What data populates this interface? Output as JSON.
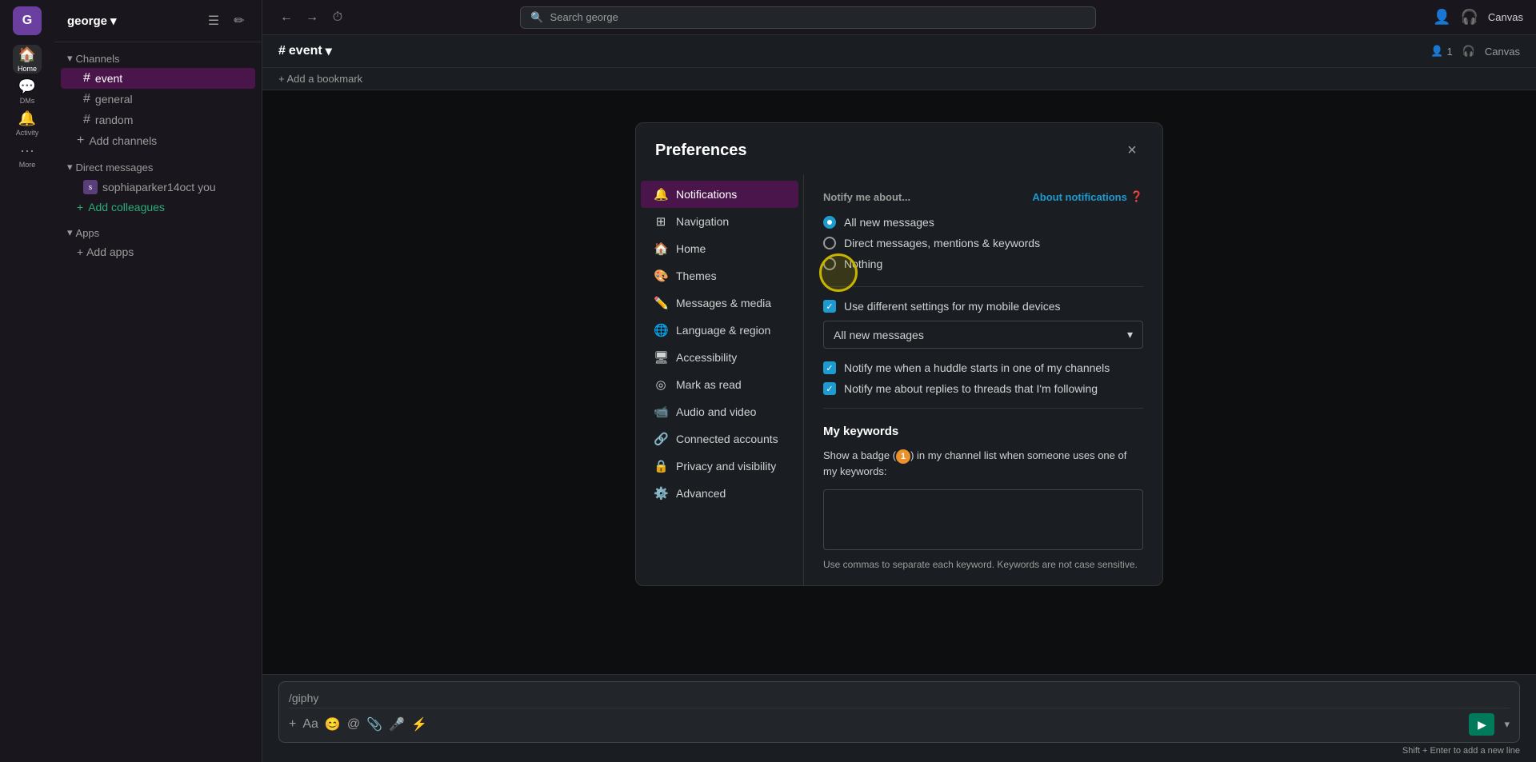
{
  "app": {
    "workspace_initial": "G",
    "workspace_name": "george",
    "workspace_arrow": "▾"
  },
  "app_sidebar": {
    "items": [
      {
        "id": "home",
        "icon": "🏠",
        "label": "Home",
        "active": true
      },
      {
        "id": "dms",
        "icon": "💬",
        "label": "DMs",
        "active": false
      },
      {
        "id": "activity",
        "icon": "🔔",
        "label": "Activity",
        "active": false
      },
      {
        "id": "more",
        "icon": "•••",
        "label": "More",
        "active": false
      }
    ]
  },
  "sidebar": {
    "channels_label": "Channels",
    "channels": [
      {
        "name": "event",
        "active": true
      },
      {
        "name": "general",
        "active": false
      },
      {
        "name": "random",
        "active": false
      }
    ],
    "add_channels": "Add channels",
    "direct_messages_label": "Direct messages",
    "dms": [
      {
        "name": "sophiaparker14oct",
        "suffix": "you"
      }
    ],
    "add_colleagues": "Add colleagues",
    "apps_label": "Apps",
    "add_apps": "Add apps"
  },
  "topbar": {
    "search_placeholder": "Search george",
    "canvas_label": "Canvas"
  },
  "channel": {
    "hash": "#",
    "name": "event",
    "arrow": "▾",
    "members_count": "1",
    "members_icon": "👤",
    "headphones_label": "Huddle",
    "canvas_label": "Canvas"
  },
  "bookmark": {
    "add_label": "+ Add a bookmark"
  },
  "input": {
    "placeholder": "/giphy",
    "shift_hint": "Shift + Enter to add a new line"
  },
  "modal": {
    "title": "Preferences",
    "close_label": "×",
    "sidebar_items": [
      {
        "id": "notifications",
        "icon": "🔔",
        "label": "Notifications",
        "active": true
      },
      {
        "id": "navigation",
        "icon": "⊞",
        "label": "Navigation",
        "active": false
      },
      {
        "id": "home",
        "icon": "🏠",
        "label": "Home",
        "active": false
      },
      {
        "id": "themes",
        "icon": "🎨",
        "label": "Themes",
        "active": false
      },
      {
        "id": "messages",
        "icon": "✏️",
        "label": "Messages & media",
        "active": false
      },
      {
        "id": "language",
        "icon": "🌐",
        "label": "Language & region",
        "active": false
      },
      {
        "id": "accessibility",
        "icon": "🖥",
        "label": "Accessibility",
        "active": false
      },
      {
        "id": "mark_read",
        "icon": "◎",
        "label": "Mark as read",
        "active": false
      },
      {
        "id": "audio_video",
        "icon": "📹",
        "label": "Audio and video",
        "active": false
      },
      {
        "id": "connected",
        "icon": "🔗",
        "label": "Connected accounts",
        "active": false
      },
      {
        "id": "privacy",
        "icon": "🔒",
        "label": "Privacy and visibility",
        "active": false
      },
      {
        "id": "advanced",
        "icon": "⚙️",
        "label": "Advanced",
        "active": false
      }
    ],
    "content": {
      "notify_title": "Notify me about...",
      "about_link": "About notifications",
      "radio_options": [
        {
          "id": "all",
          "label": "All new messages",
          "checked": true
        },
        {
          "id": "dm",
          "label": "Direct messages, mentions & keywords",
          "checked": false
        },
        {
          "id": "nothing",
          "label": "Nothing",
          "checked": false
        }
      ],
      "mobile_label": "Use different settings for my mobile devices",
      "mobile_checked": true,
      "mobile_dropdown": "All new messages",
      "mobile_dropdown_arrow": "▾",
      "huddle_label": "Notify me when a huddle starts in one of my channels",
      "huddle_checked": true,
      "replies_label": "Notify me about replies to threads that I'm following",
      "replies_checked": true,
      "keywords_title": "My keywords",
      "keywords_desc_before": "Show a badge (",
      "keywords_badge": "1",
      "keywords_desc_after": ") in my channel list when someone uses one of my keywords:",
      "keywords_placeholder": "",
      "keywords_hint": "Use commas to separate each keyword. Keywords are not case sensitive."
    }
  }
}
